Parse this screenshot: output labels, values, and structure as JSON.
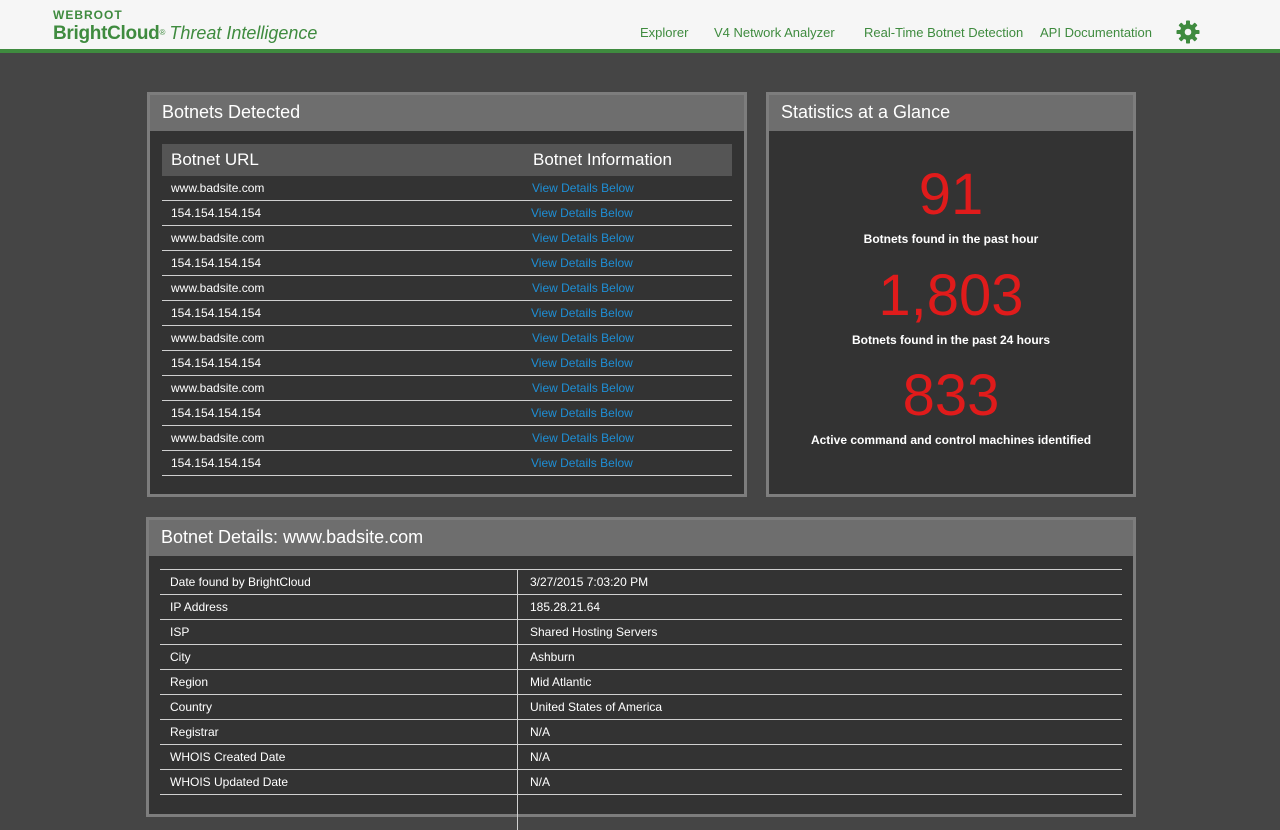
{
  "header": {
    "logo_top": "WEBROOT",
    "logo_brand": "BrightCloud",
    "logo_reg": "®",
    "logo_sub": "Threat Intelligence",
    "nav": [
      "Explorer",
      "V4 Network Analyzer",
      "Real-Time Botnet Detection",
      "API Documentation"
    ],
    "settings_icon": "gear-icon",
    "accent_color": "#3f8b3f"
  },
  "botnets": {
    "title": "Botnets Detected",
    "col_url": "Botnet URL",
    "col_info": "Botnet Information",
    "link_color": "#1e8fd6",
    "rows": [
      {
        "url": "www.badsite.com",
        "info": "View Details Below"
      },
      {
        "url": "154.154.154.154",
        "info": "View Details Below"
      },
      {
        "url": "www.badsite.com",
        "info": "View Details Below"
      },
      {
        "url": "154.154.154.154",
        "info": "View Details Below"
      },
      {
        "url": "www.badsite.com",
        "info": "View Details Below"
      },
      {
        "url": "154.154.154.154",
        "info": "View Details Below"
      },
      {
        "url": "www.badsite.com",
        "info": "View Details Below"
      },
      {
        "url": "154.154.154.154",
        "info": "View Details Below"
      },
      {
        "url": "www.badsite.com",
        "info": "View Details Below"
      },
      {
        "url": "154.154.154.154",
        "info": "View Details Below"
      },
      {
        "url": "www.badsite.com",
        "info": "View Details Below"
      },
      {
        "url": "154.154.154.154",
        "info": "View Details Below"
      }
    ]
  },
  "stats": {
    "title": "Statistics at a Glance",
    "number_color": "#e01b1b",
    "items": [
      {
        "value": "91",
        "label": "Botnets found in the past hour"
      },
      {
        "value": "1,803",
        "label": "Botnets found in the past 24 hours"
      },
      {
        "value": "833",
        "label": "Active command and control machines identified"
      }
    ]
  },
  "details": {
    "title": "Botnet Details: www.badsite.com",
    "rows": [
      {
        "key": "Date found by BrightCloud",
        "value": "3/27/2015 7:03:20 PM"
      },
      {
        "key": "IP Address",
        "value": "185.28.21.64"
      },
      {
        "key": "ISP",
        "value": "Shared Hosting Servers"
      },
      {
        "key": "City",
        "value": "Ashburn"
      },
      {
        "key": "Region",
        "value": "Mid Atlantic"
      },
      {
        "key": "Country",
        "value": "United States of America"
      },
      {
        "key": "Registrar",
        "value": "N/A"
      },
      {
        "key": "WHOIS Created Date",
        "value": "N/A"
      },
      {
        "key": "WHOIS Updated Date",
        "value": "N/A"
      }
    ]
  }
}
